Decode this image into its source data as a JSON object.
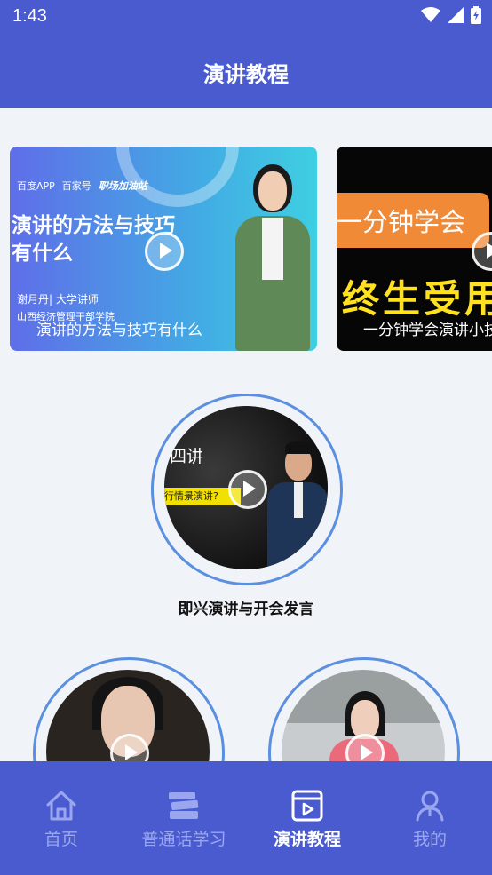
{
  "status": {
    "time": "1:43"
  },
  "header": {
    "title": "演讲教程"
  },
  "featured": [
    {
      "brand_a": "百度APP",
      "brand_b": "百家号",
      "brand_c": "职场加油站",
      "headline": "演讲的方法与技巧有什么",
      "speaker": "谢月丹| 大学讲师",
      "org": "山西经济管理干部学院",
      "caption": "演讲的方法与技巧有什么"
    },
    {
      "top_text": "一分钟学会",
      "big_text": "终生受用",
      "caption": "一分钟学会演讲小技巧"
    }
  ],
  "courses": [
    {
      "title": "即兴演讲与开会发言",
      "thumb_text": "四讲",
      "thumb_tag": "行情景演讲?"
    },
    {
      "title": ""
    },
    {
      "title": ""
    }
  ],
  "tabs": [
    {
      "label": "首页",
      "icon": "home-icon"
    },
    {
      "label": "普通话学习",
      "icon": "books-icon"
    },
    {
      "label": "演讲教程",
      "icon": "video-icon",
      "active": true
    },
    {
      "label": "我的",
      "icon": "profile-icon"
    }
  ],
  "colors": {
    "primary": "#4a5bd0",
    "inactive_tab": "#9aa7ef",
    "ring": "#5b8fe0",
    "background": "#f0f3f7"
  }
}
